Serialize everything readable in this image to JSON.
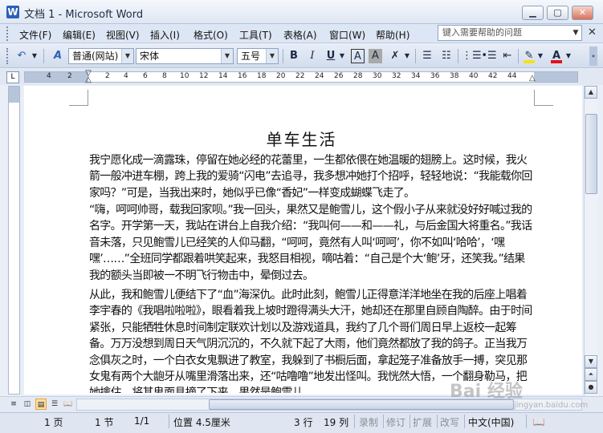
{
  "window": {
    "title": "文档 1 - Microsoft Word",
    "buttons": [
      "minimize",
      "maximize",
      "close"
    ]
  },
  "menu": {
    "items": [
      "文件(F)",
      "编辑(E)",
      "视图(V)",
      "插入(I)",
      "格式(O)",
      "工具(T)",
      "表格(A)",
      "窗口(W)",
      "帮助(H)"
    ],
    "help_placeholder": "键入需要帮助的问题"
  },
  "toolbar": {
    "style": "普通(网站)",
    "font": "宋体",
    "size": "五号",
    "bold": "B",
    "italic": "I",
    "underline": "U",
    "border_a": "A",
    "shade_a": "A"
  },
  "ruler": {
    "numbers": [
      "4",
      "2",
      "2",
      "4",
      "6",
      "8",
      "10",
      "12",
      "14",
      "16",
      "18",
      "20",
      "22",
      "24",
      "26",
      "28",
      "30",
      "32",
      "34",
      "36",
      "38",
      "40",
      "42",
      "44"
    ]
  },
  "document": {
    "title": "单车生活",
    "paragraphs": [
      "我宁愿化成一滴露珠，停留在她必经的花蕾里，一生都依偎在她温暖的翅膀上。这时候，我火箭一般冲进车棚，跨上我的爱骑“闪电”去追寻，我多想冲她打个招呼，轻轻地说：“我能载你回家吗？”可是，当我出来时，她似乎已像“香妃”一样变成蝴蝶飞走了。",
      "“嗨，呵呵帅哥，载我回家呗。”我一回头，果然又是鲍雪儿，这个假小子从来就没好好喊过我的名字。开学第一天，我站在讲台上自我介绍：“我叫何——和——礼，与后金国大将重名。”我话音未落，只见鲍雪儿已经笑的人仰马翻，“呵呵，竟然有人叫‘呵呵’，你不如叫‘哈哈’，‘嘿嘿’……”全班同学都跟着哄笑起来，我怒目相视，嘀咕着：“自己是个大‘鲍’牙，还笑我。”结果我的额头当即被一不明飞行物击中，晕倒过去。",
      "从此，我和鲍雪儿便结下了“血”海深仇。此时此刻，鲍雪儿正得意洋洋地坐在我的后座上唱着李宇春的《我唱啦啦啦》，眼看着我上坡时蹬得满头大汗，她却还在那里自顾自陶醉。由于时间紧张，只能牺牲休息时间制定联欢计划以及游戏道具，我约了几个哥们周日早上返校一起筹备。万万没想到周日天气阴沉沉的，不久就下起了大雨，他们竟然都放了我的鸽子。正当我万念俱灰之时，一个白衣女鬼飘进了教室，我躲到了书橱后面，拿起笼子准备放手一搏，突见那女鬼有两个大龅牙从嘴里滑落出来，还“咕噜噜”地发出怪叫。我恍然大悟，一个翻身勒马，把她擒住，将其鬼面具摘了下来，果然是鲍雪儿。"
    ]
  },
  "status": {
    "page": "1 页",
    "section": "1 节",
    "pages": "1/1",
    "position": "位置 4.5厘米",
    "line": "3 行",
    "column": "19 列",
    "rec": "录制",
    "trk": "修订",
    "ext": "扩展",
    "ovr": "改写",
    "language": "中文(中国)"
  },
  "watermark": {
    "text": "Bai 经验",
    "url": "jingyan.baidu.com"
  },
  "colors": {
    "highlight": "#f4e21c",
    "font_color": "#e0121b",
    "accent": "#2b5fb8"
  }
}
